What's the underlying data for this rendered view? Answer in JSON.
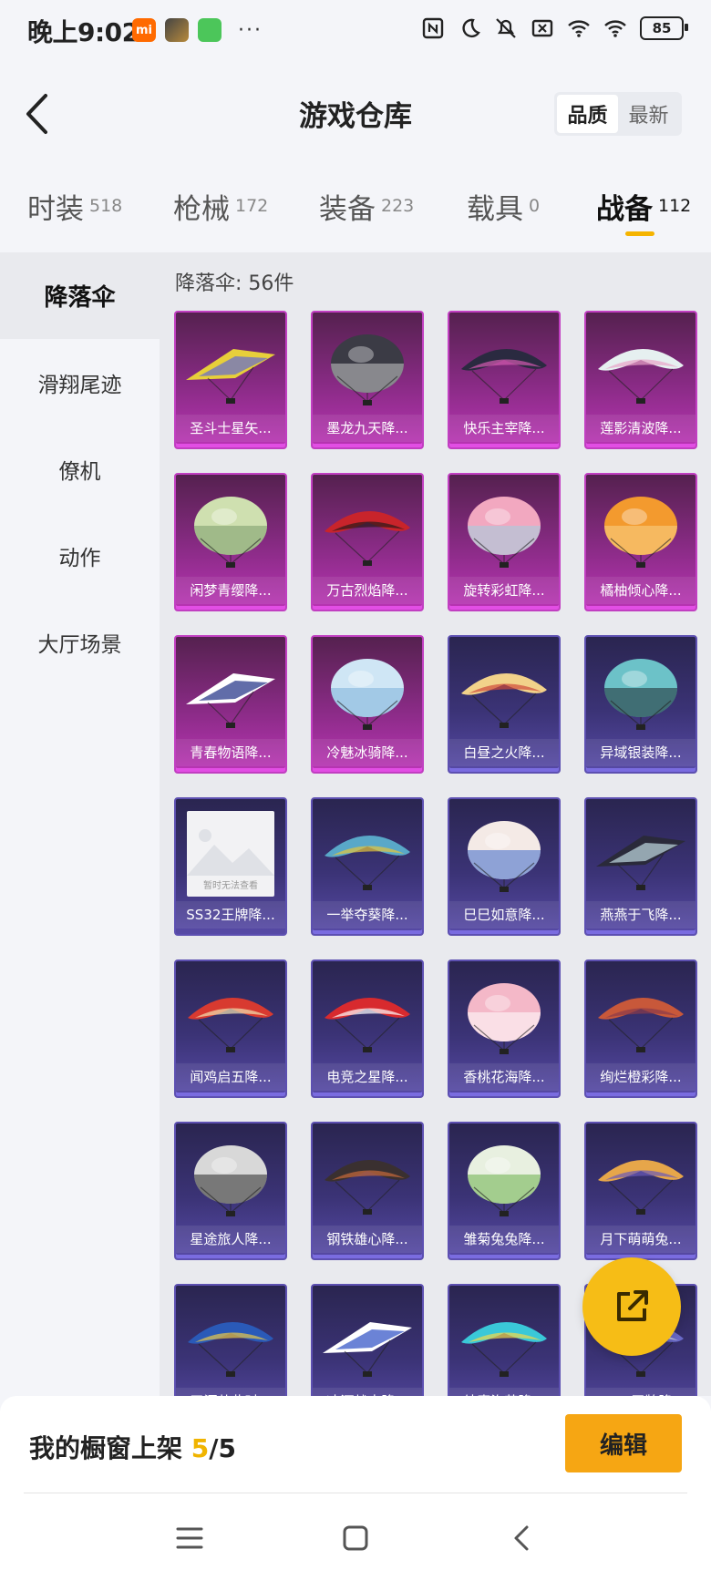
{
  "status_bar": {
    "time": "晚上9:02",
    "mi_label": "mi",
    "more_dots": "···",
    "battery": "85",
    "icons": [
      "nfc-icon",
      "moon-icon",
      "bell-off-icon",
      "sim-icon",
      "wifi-icon",
      "wifi-icon-2",
      "battery-icon"
    ]
  },
  "header": {
    "title": "游戏仓库",
    "sort_options": [
      "品质",
      "最新"
    ]
  },
  "tabs": [
    {
      "label": "时装",
      "count": "518"
    },
    {
      "label": "枪械",
      "count": "172"
    },
    {
      "label": "装备",
      "count": "223"
    },
    {
      "label": "载具",
      "count": "0"
    },
    {
      "label": "战备",
      "count": "112"
    }
  ],
  "sidebar": {
    "items": [
      "降落伞",
      "滑翔尾迹",
      "僚机",
      "动作",
      "大厅场景"
    ]
  },
  "content": {
    "category_title": "降落伞: 56件",
    "placeholder_text": "暂时无法查看",
    "items": [
      {
        "name": "圣斗士星矢...",
        "rarity": "purple",
        "art": "glider",
        "c1": "#e7cf3a",
        "c2": "#6b70c8"
      },
      {
        "name": "墨龙九天降...",
        "rarity": "purple",
        "art": "dome",
        "c1": "#3b3b45",
        "c2": "#c8c8c8"
      },
      {
        "name": "快乐主宰降...",
        "rarity": "purple",
        "art": "wing",
        "c1": "#2a2a40",
        "c2": "#d45ab0"
      },
      {
        "name": "莲影清波降...",
        "rarity": "purple",
        "art": "wing",
        "c1": "#e6f0f0",
        "c2": "#e8a2c8"
      },
      {
        "name": "闲梦青缨降...",
        "rarity": "purple",
        "art": "dome",
        "c1": "#cfe0b0",
        "c2": "#7a9a6a"
      },
      {
        "name": "万古烈焰降...",
        "rarity": "purple",
        "art": "wing",
        "c1": "#c8242b",
        "c2": "#2a1a1a"
      },
      {
        "name": "旋转彩虹降...",
        "rarity": "purple",
        "art": "dome",
        "c1": "#f2a8c0",
        "c2": "#9fd0e0"
      },
      {
        "name": "橘柚倾心降...",
        "rarity": "purple",
        "art": "dome",
        "c1": "#f39a2e",
        "c2": "#f7d38a"
      },
      {
        "name": "青春物语降...",
        "rarity": "purple",
        "art": "glider",
        "c1": "#ffffff",
        "c2": "#2c3c8c"
      },
      {
        "name": "冷魅冰骑降...",
        "rarity": "purple",
        "art": "dome",
        "c1": "#cfe6f5",
        "c2": "#7db0d8"
      },
      {
        "name": "白昼之火降...",
        "rarity": "blue",
        "art": "wing",
        "c1": "#f2d28a",
        "c2": "#d04a3a"
      },
      {
        "name": "异域银装降...",
        "rarity": "blue",
        "art": "dome",
        "c1": "#6cc2c8",
        "c2": "#1e2a30"
      },
      {
        "name": "SS32王牌降...",
        "rarity": "noimg",
        "art": "none",
        "c1": "#cccccc",
        "c2": "#999999"
      },
      {
        "name": "一举夺葵降...",
        "rarity": "blue",
        "art": "wing",
        "c1": "#59a8c8",
        "c2": "#e6c43a"
      },
      {
        "name": "巳巳如意降...",
        "rarity": "blue",
        "art": "dome",
        "c1": "#f4eae6",
        "c2": "#3a66c8"
      },
      {
        "name": "燕燕于飞降...",
        "rarity": "blue",
        "art": "glider",
        "c1": "#2a2a3a",
        "c2": "#b8d0d8"
      },
      {
        "name": "闻鸡启五降...",
        "rarity": "blue",
        "art": "wing",
        "c1": "#d83a30",
        "c2": "#f2e2b0"
      },
      {
        "name": "电竞之星降...",
        "rarity": "blue",
        "art": "wing",
        "c1": "#d82a2e",
        "c2": "#ffffff"
      },
      {
        "name": "香桃花海降...",
        "rarity": "blue",
        "art": "dome",
        "c1": "#f4b8c8",
        "c2": "#ffffff"
      },
      {
        "name": "绚烂橙彩降...",
        "rarity": "blue",
        "art": "wing",
        "c1": "#c8583a",
        "c2": "#8a3a4a"
      },
      {
        "name": "星途旅人降...",
        "rarity": "blue",
        "art": "dome",
        "c1": "#d8d8d8",
        "c2": "#2a2a2a"
      },
      {
        "name": "钢铁雄心降...",
        "rarity": "blue",
        "art": "wing",
        "c1": "#3a3030",
        "c2": "#c86a3a"
      },
      {
        "name": "雏菊兔兔降...",
        "rarity": "blue",
        "art": "dome",
        "c1": "#e8f0e0",
        "c2": "#6ab04a"
      },
      {
        "name": "月下萌萌兔...",
        "rarity": "blue",
        "art": "wing",
        "c1": "#e6a64a",
        "c2": "#6a5ab8"
      },
      {
        "name": "天涯共此时...",
        "rarity": "blue",
        "art": "wing",
        "c1": "#2a5ab8",
        "c2": "#e8c84a"
      },
      {
        "name": "冰河战士降...",
        "rarity": "blue",
        "art": "glider",
        "c1": "#ffffff",
        "c2": "#3a5ac8"
      },
      {
        "name": "纯真泡芙降...",
        "rarity": "blue",
        "art": "wing",
        "c1": "#3ac8d8",
        "c2": "#f2d84a"
      },
      {
        "name": "SS28王牌降...",
        "rarity": "blue",
        "art": "wing",
        "c1": "#6a6ac8",
        "c2": "#e0e0e0"
      }
    ]
  },
  "bottom_bar": {
    "showcase_label": "我的橱窗上架",
    "showcase_current": "5",
    "showcase_total": "/5",
    "edit_label": "编辑"
  },
  "colors": {
    "accent": "#f6bd16",
    "edit_button": "#f6a613",
    "purple_card": "#8a2b86",
    "blue_card": "#3b3376"
  }
}
